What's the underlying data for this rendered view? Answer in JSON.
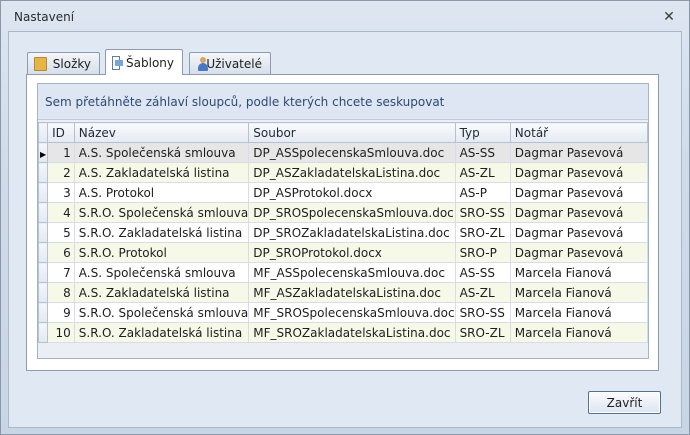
{
  "window": {
    "title": "Nastavení",
    "close_glyph": "✕"
  },
  "tabs": [
    {
      "label": "Složky",
      "icon": "folder-icon",
      "active": false
    },
    {
      "label": "Šablony",
      "icon": "template-icon",
      "active": true
    },
    {
      "label": "Uživatelé",
      "icon": "user-icon",
      "active": false
    }
  ],
  "grid": {
    "group_panel_text": "Sem přetáhněte záhlaví sloupců, podle kterých chcete seskupovat",
    "columns": [
      "ID",
      "Název",
      "Soubor",
      "Typ",
      "Notář"
    ],
    "focused_row_indicator": "▶",
    "rows": [
      {
        "id": "1",
        "nazev": "A.S. Společenská smlouva",
        "soubor": "DP_ASSpolecenskaSmlouva.doc",
        "typ": "AS-SS",
        "notar": "Dagmar Pasevová"
      },
      {
        "id": "2",
        "nazev": "A.S. Zakladatelská listina",
        "soubor": "DP_ASZakladatelskaListina.doc",
        "typ": "AS-ZL",
        "notar": "Dagmar Pasevová"
      },
      {
        "id": "3",
        "nazev": "A.S. Protokol",
        "soubor": "DP_ASProtokol.docx",
        "typ": "AS-P",
        "notar": "Dagmar Pasevová"
      },
      {
        "id": "4",
        "nazev": "S.R.O. Společenská smlouva",
        "soubor": "DP_SROSpolecenskaSmlouva.doc",
        "typ": "SRO-SS",
        "notar": "Dagmar Pasevová"
      },
      {
        "id": "5",
        "nazev": "S.R.O. Zakladatelská listina",
        "soubor": "DP_SROZakladatelskaListina.doc",
        "typ": "SRO-ZL",
        "notar": "Dagmar Pasevová"
      },
      {
        "id": "6",
        "nazev": "S.R.O. Protokol",
        "soubor": "DP_SROProtokol.docx",
        "typ": "SRO-P",
        "notar": "Dagmar Pasevová"
      },
      {
        "id": "7",
        "nazev": "A.S. Společenská smlouva",
        "soubor": "MF_ASSpolecenskaSmlouva.doc",
        "typ": "AS-SS",
        "notar": "Marcela Fianová"
      },
      {
        "id": "8",
        "nazev": "A.S. Zakladatelská listina",
        "soubor": "MF_ASZakladatelskaListina.doc",
        "typ": "AS-ZL",
        "notar": "Marcela Fianová"
      },
      {
        "id": "9",
        "nazev": "S.R.O. Společenská smlouva",
        "soubor": "MF_SROSpolecenskaSmlouva.doc",
        "typ": "SRO-SS",
        "notar": "Marcela Fianová"
      },
      {
        "id": "10",
        "nazev": "S.R.O. Zakladatelská listina",
        "soubor": "MF_SROZakladatelskaListina.doc",
        "typ": "SRO-ZL",
        "notar": "Marcela Fianová"
      }
    ]
  },
  "footer": {
    "close_button": "Zavřít"
  }
}
